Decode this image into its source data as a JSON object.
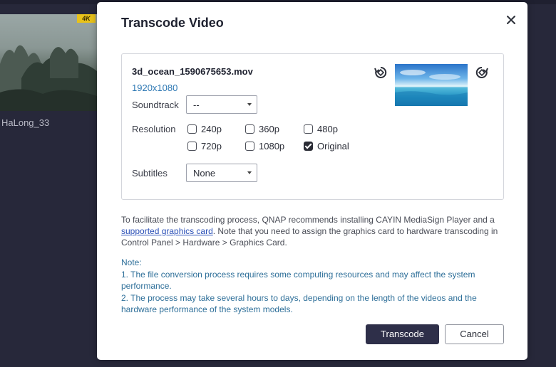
{
  "background": {
    "badge": "4K",
    "item_label": "HaLong_33"
  },
  "dialog": {
    "title": "Transcode Video",
    "file": {
      "name": "3d_ocean_1590675653.mov",
      "resolution": "1920x1080"
    },
    "soundtrack": {
      "label": "Soundtrack",
      "value": "--"
    },
    "resolution": {
      "label": "Resolution",
      "options": [
        {
          "label": "240p",
          "checked": false
        },
        {
          "label": "360p",
          "checked": false
        },
        {
          "label": "480p",
          "checked": false
        },
        {
          "label": "720p",
          "checked": false
        },
        {
          "label": "1080p",
          "checked": false
        },
        {
          "label": "Original",
          "checked": true
        }
      ]
    },
    "subtitles": {
      "label": "Subtitles",
      "value": "None"
    },
    "info": {
      "text_before": "To facilitate the transcoding process, QNAP recommends installing CAYIN MediaSign Player and a ",
      "link": "supported graphics card",
      "text_after": ". Note that you need to assign the graphics card to hardware transcoding in Control Panel > Hardware > Graphics Card."
    },
    "note": {
      "heading": "Note:",
      "item1": "1. The file conversion process requires some computing resources and may affect the system performance.",
      "item2": "2. The process may take several hours to days, depending on the length of the videos and the hardware performance of the system models."
    },
    "buttons": {
      "primary": "Transcode",
      "cancel": "Cancel"
    }
  },
  "icons": {
    "close": "close-icon",
    "rotate_left": "rotate-left-icon",
    "rotate_right": "rotate-right-icon"
  },
  "colors": {
    "primary_button": "#2e2f49",
    "link": "#2b50b7",
    "note_text": "#2e6f99",
    "resolution_text": "#2f79b4"
  }
}
